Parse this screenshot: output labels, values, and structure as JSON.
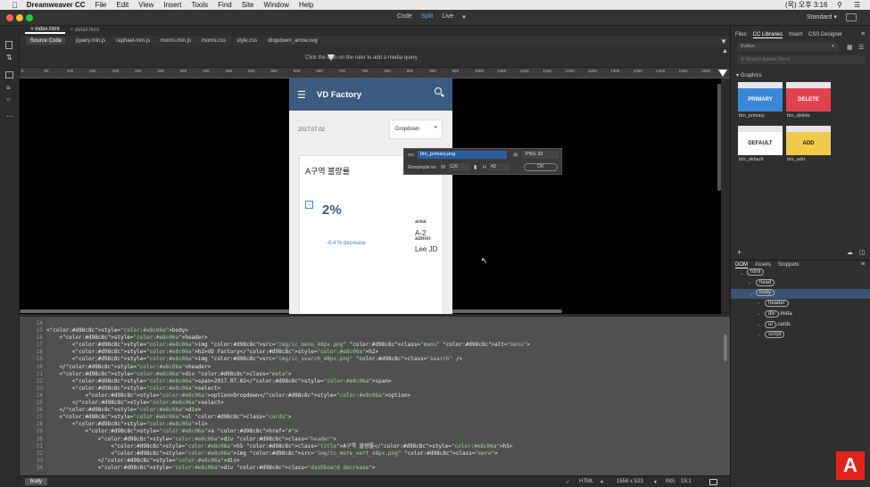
{
  "menubar": {
    "app": "Dreamweaver CC",
    "items": [
      "File",
      "Edit",
      "View",
      "Insert",
      "Tools",
      "Find",
      "Site",
      "Window",
      "Help"
    ],
    "clock": "(목) 오후 3:16"
  },
  "titlebar": {
    "views": [
      "Code",
      "Split",
      "Live"
    ],
    "active_view": "Split",
    "workspace": "Standard"
  },
  "doc_tabs": [
    "index.html",
    "detail.html"
  ],
  "related_files": [
    "Source Code",
    "jquery.min.js",
    "raphael-min.js",
    "morris.min.js",
    "morris.css",
    "style.css",
    "dropdown_arrow.svg"
  ],
  "media_query_hint": "Click the  icon on the ruler to add a media query",
  "ruler_ticks": [
    "0",
    "50",
    "100",
    "150",
    "200",
    "250",
    "300",
    "350",
    "400",
    "450",
    "500",
    "550",
    "600",
    "650",
    "700",
    "750",
    "800",
    "850",
    "900",
    "950",
    "1000",
    "1050",
    "1100",
    "1150",
    "1200",
    "1250",
    "1300",
    "1350",
    "1400",
    "1450",
    "1500"
  ],
  "phone": {
    "title": "VD Factory",
    "date": "2017.07.02",
    "dropdown": "Dropdown",
    "card_title": "A구역 불량률",
    "percent": "2%",
    "decrease": "-0.4 % decrease",
    "area_label": "area",
    "area_value": "A-2",
    "admin_label": "admin",
    "admin_value": "Lee JD"
  },
  "image_popup": {
    "src_label": "src",
    "src_value": "btn_primary.png",
    "format": "PNG 32",
    "resample_label": "Resample to:",
    "w_label": "W",
    "w_value": "120",
    "h_label": "H",
    "h_value": "42",
    "ok": "OK"
  },
  "code": {
    "line_numbers": [
      "14",
      "15",
      "16",
      "17",
      "18",
      "19",
      "20",
      "21",
      "22",
      "23",
      "24",
      "25",
      "26",
      "27",
      "28",
      "29",
      "30",
      "31",
      "32",
      "33",
      "34"
    ],
    "lines": [
      "",
      "<body>",
      "    <header>",
      "        <img src=\"img/ic_menu_48px.png\" class=\"menu\" alt=\"menu\">",
      "        <h2>VD Factory</h2>",
      "        <img src=\"img/ic_search_48px.png\" class=\"search\" />",
      "    </header>",
      "    <div class=\"meta\">",
      "        <span>2017.07.02</span>",
      "        <select>",
      "            <option>Dropdown</option>",
      "        </select>",
      "    </div>",
      "    <ul class=\"cards\">",
      "        <li>",
      "            <a href=\"#\">",
      "                <div class=\"header\">",
      "                    <h5 class=\"title\">A구역 불량률</h5>",
      "                    <img src=\"img/ic_more_vert_48px.png\" class=\"more\">",
      "                </div>",
      "                <div class=\"dashboard decrease\">"
    ]
  },
  "statusbar": {
    "tag": "body",
    "lang": "HTML",
    "size": "1558 x 523",
    "mode": "INS",
    "pos": "15:1"
  },
  "panel": {
    "tabs": [
      "Files",
      "CC Libraries",
      "Insert",
      "CSS Designer"
    ],
    "active_tab": "CC Libraries",
    "library": "Button",
    "search_placeholder": "Search Adobe Stock",
    "section": "Graphics",
    "tiles": [
      {
        "label": "PRIMARY",
        "name": "btn_primary",
        "bg": "#3a86d8",
        "fg": "#ffffff"
      },
      {
        "label": "DELETE",
        "name": "btn_delete",
        "bg": "#e0424f",
        "fg": "#ffffff"
      },
      {
        "label": "DEFAULT",
        "name": "btn_default",
        "bg": "#ffffff",
        "fg": "#222222"
      },
      {
        "label": "ADD",
        "name": "btn_add",
        "bg": "#f2c94c",
        "fg": "#222222"
      }
    ],
    "dom_tabs": [
      "DOM",
      "Assets",
      "Snippets"
    ],
    "dom_tree": [
      {
        "tag": "html",
        "indent": 0
      },
      {
        "tag": "head",
        "indent": 1
      },
      {
        "tag": "body",
        "indent": 1
      },
      {
        "tag": "header",
        "indent": 2
      },
      {
        "tag": "div",
        "suffix": ".meta",
        "indent": 2
      },
      {
        "tag": "ul",
        "suffix": ".cards",
        "indent": 2
      },
      {
        "tag": "script",
        "indent": 2
      }
    ]
  }
}
